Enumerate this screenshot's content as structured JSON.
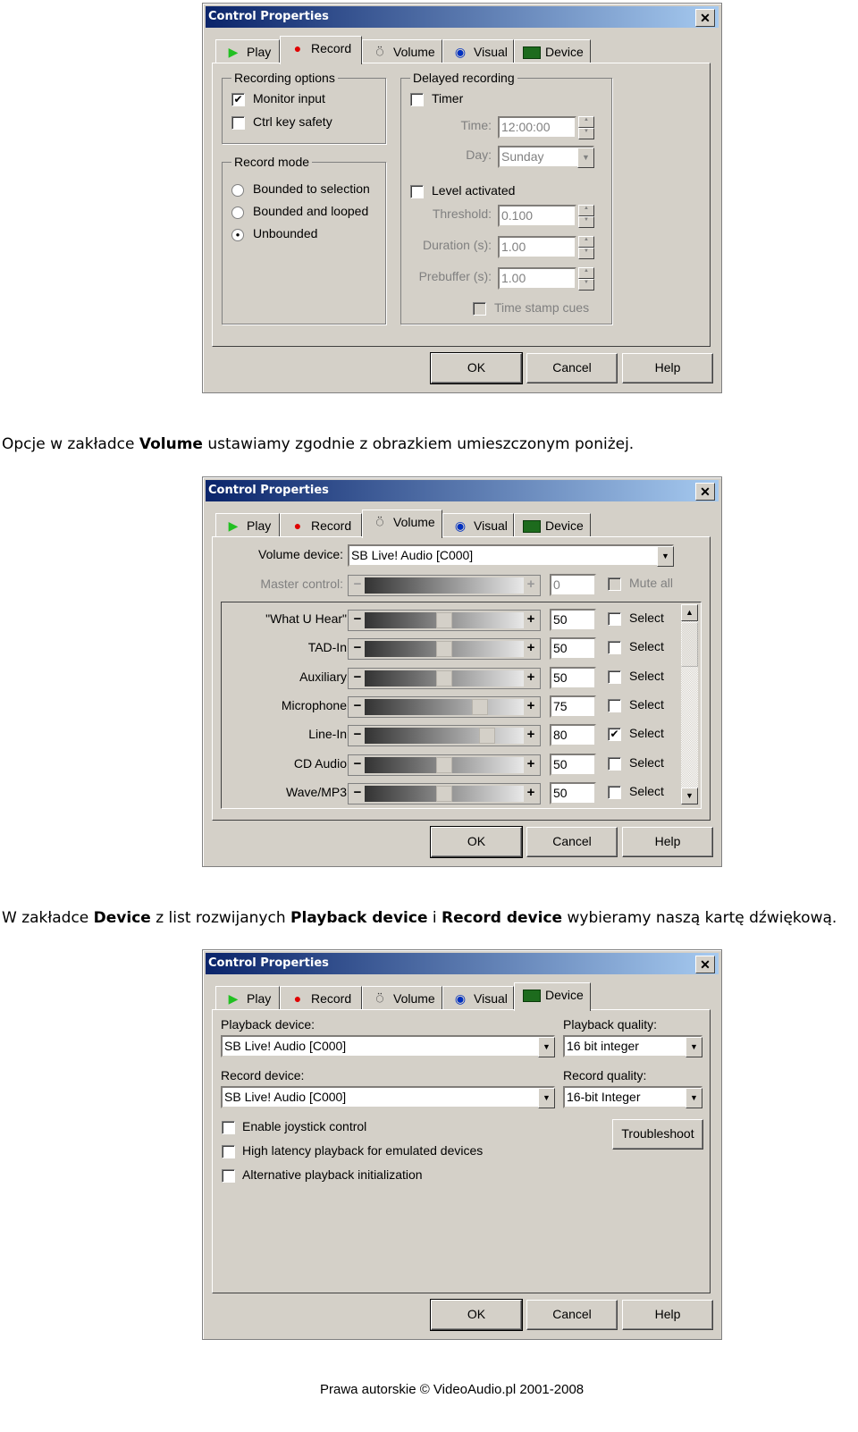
{
  "window_title": "Control Properties",
  "tabs": [
    {
      "label": "Play",
      "icon": "play-icon",
      "color": "#22c022"
    },
    {
      "label": "Record",
      "icon": "record-dot-icon",
      "color": "#e00000"
    },
    {
      "label": "Volume",
      "icon": "volume-knob-icon"
    },
    {
      "label": "Visual",
      "icon": "eye-icon"
    },
    {
      "label": "Device",
      "icon": "sound-card-icon"
    }
  ],
  "buttons": {
    "ok": "OK",
    "cancel": "Cancel",
    "help": "Help"
  },
  "record_tab": {
    "recording_options": {
      "title": "Recording options",
      "monitor_input": {
        "label": "Monitor input",
        "checked": true
      },
      "ctrl_key_safety": {
        "label": "Ctrl key safety",
        "checked": false
      }
    },
    "record_mode": {
      "title": "Record mode",
      "options": [
        "Bounded to selection",
        "Bounded and looped",
        "Unbounded"
      ],
      "selected": "Unbounded"
    },
    "delayed": {
      "title": "Delayed recording",
      "timer": {
        "label": "Timer",
        "checked": false
      },
      "time_label": "Time:",
      "time_value": "12:00:00",
      "day_label": "Day:",
      "day_value": "Sunday",
      "level_activated": {
        "label": "Level activated",
        "checked": false
      },
      "threshold_label": "Threshold:",
      "threshold_value": "0.100",
      "duration_label": "Duration (s):",
      "duration_value": "1.00",
      "prebuffer_label": "Prebuffer (s):",
      "prebuffer_value": "1.00",
      "time_stamp_cues": {
        "label": "Time stamp cues",
        "checked": false
      }
    }
  },
  "para1": {
    "before": "Opcje w zakładce ",
    "bold": "Volume",
    "after": " ustawiamy zgodnie z obrazkiem umieszczonym poniżej."
  },
  "volume_tab": {
    "device_label": "Volume device:",
    "device_value": "SB Live! Audio [C000]",
    "master_label": "Master control:",
    "master_value": "0",
    "mute_all": "Mute all",
    "select_label": "Select",
    "channels": [
      {
        "name": "\"What U Hear\"",
        "value": 50,
        "select": false
      },
      {
        "name": "TAD-In",
        "value": 50,
        "select": false
      },
      {
        "name": "Auxiliary",
        "value": 50,
        "select": false
      },
      {
        "name": "Microphone",
        "value": 75,
        "select": false
      },
      {
        "name": "Line-In",
        "value": 80,
        "select": true
      },
      {
        "name": "CD Audio",
        "value": 50,
        "select": false
      },
      {
        "name": "Wave/MP3",
        "value": 50,
        "select": false
      }
    ]
  },
  "para2": {
    "t1": "W zakładce ",
    "b1": "Device",
    "t2": " z list rozwijanych ",
    "b2": "Playback device",
    "t3": " i ",
    "b3": "Record device",
    "t4": " wybieramy naszą kartę dźwiękową."
  },
  "device_tab": {
    "playback_device_label": "Playback device:",
    "playback_device_value": "SB Live! Audio [C000]",
    "playback_quality_label": "Playback quality:",
    "playback_quality_value": "16 bit integer",
    "record_device_label": "Record device:",
    "record_device_value": "SB Live! Audio [C000]",
    "record_quality_label": "Record quality:",
    "record_quality_value": "16-bit Integer",
    "troubleshoot": "Troubleshoot",
    "options": [
      {
        "label": "Enable joystick control",
        "checked": false
      },
      {
        "label": "High latency playback for emulated devices",
        "checked": false
      },
      {
        "label": "Alternative playback initialization",
        "checked": false
      }
    ]
  },
  "footer": "Prawa autorskie © VideoAudio.pl 2001-2008"
}
